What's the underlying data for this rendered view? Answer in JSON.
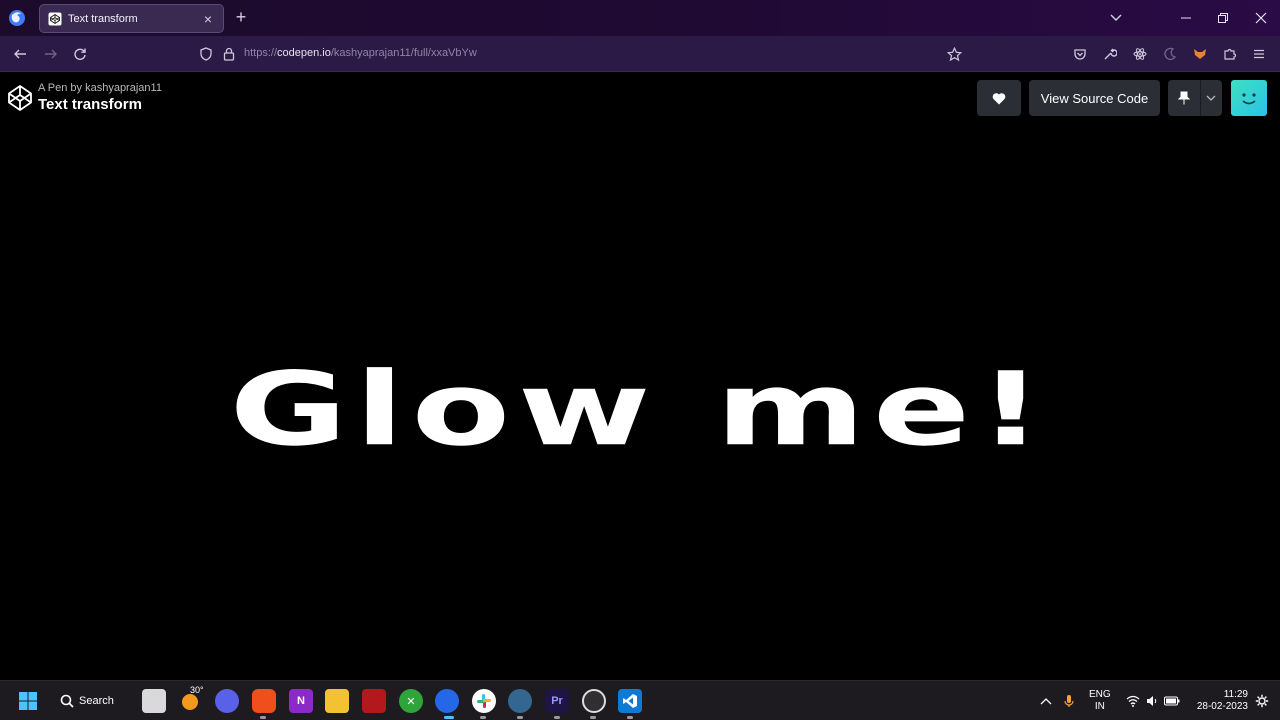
{
  "browser": {
    "tab": {
      "title": "Text transform"
    },
    "url": {
      "scheme": "https://",
      "host": "codepen.io",
      "path": "/kashyaprajan11/full/xxaVbYw"
    }
  },
  "pen": {
    "by_label": "A Pen by kashyaprajan11",
    "title": "Text transform",
    "view_source_label": "View Source Code",
    "display_text": "Glow me!"
  },
  "taskbar": {
    "search_label": "Search",
    "weather_temp": "30°",
    "language_line1": "ENG",
    "language_line2": "IN",
    "time": "11:29",
    "date": "28-02-2023"
  },
  "colors": {
    "tab_strip": "#1f0a33",
    "nav_bar": "#2b1a45",
    "page_bg": "#000000",
    "button_bg": "#2c2e36",
    "avatar_teal": "#3de0c0"
  },
  "icons": {
    "browser": [
      "firefox-icon",
      "codepen-favicon",
      "close-icon",
      "plus-icon",
      "chevron-down-icon",
      "minimize-icon",
      "restore-icon",
      "close-window-icon"
    ],
    "nav": [
      "back-arrow-icon",
      "forward-arrow-icon",
      "reload-icon",
      "shield-icon",
      "lock-icon",
      "star-icon",
      "pocket-icon",
      "wrench-icon",
      "react-icon",
      "moon-icon",
      "fox-extension-icon",
      "puzzle-icon",
      "menu-icon"
    ],
    "page": [
      "codepen-logo-icon",
      "heart-icon",
      "pin-icon",
      "chevron-down-icon",
      "avatar-smile-icon"
    ],
    "taskbar": [
      "windows-start-icon",
      "search-icon",
      "task-view-icon",
      "weather-icon",
      "zoom-icon",
      "brave-icon",
      "onenote-icon",
      "file-explorer-icon",
      "app-red-icon",
      "xbox-icon",
      "firefox-icon",
      "slack-icon",
      "postgres-icon",
      "premiere-icon",
      "obs-icon",
      "vscode-icon",
      "chevron-up-icon",
      "microphone-icon",
      "wifi-icon",
      "speaker-icon",
      "battery-icon",
      "settings-icon"
    ]
  }
}
